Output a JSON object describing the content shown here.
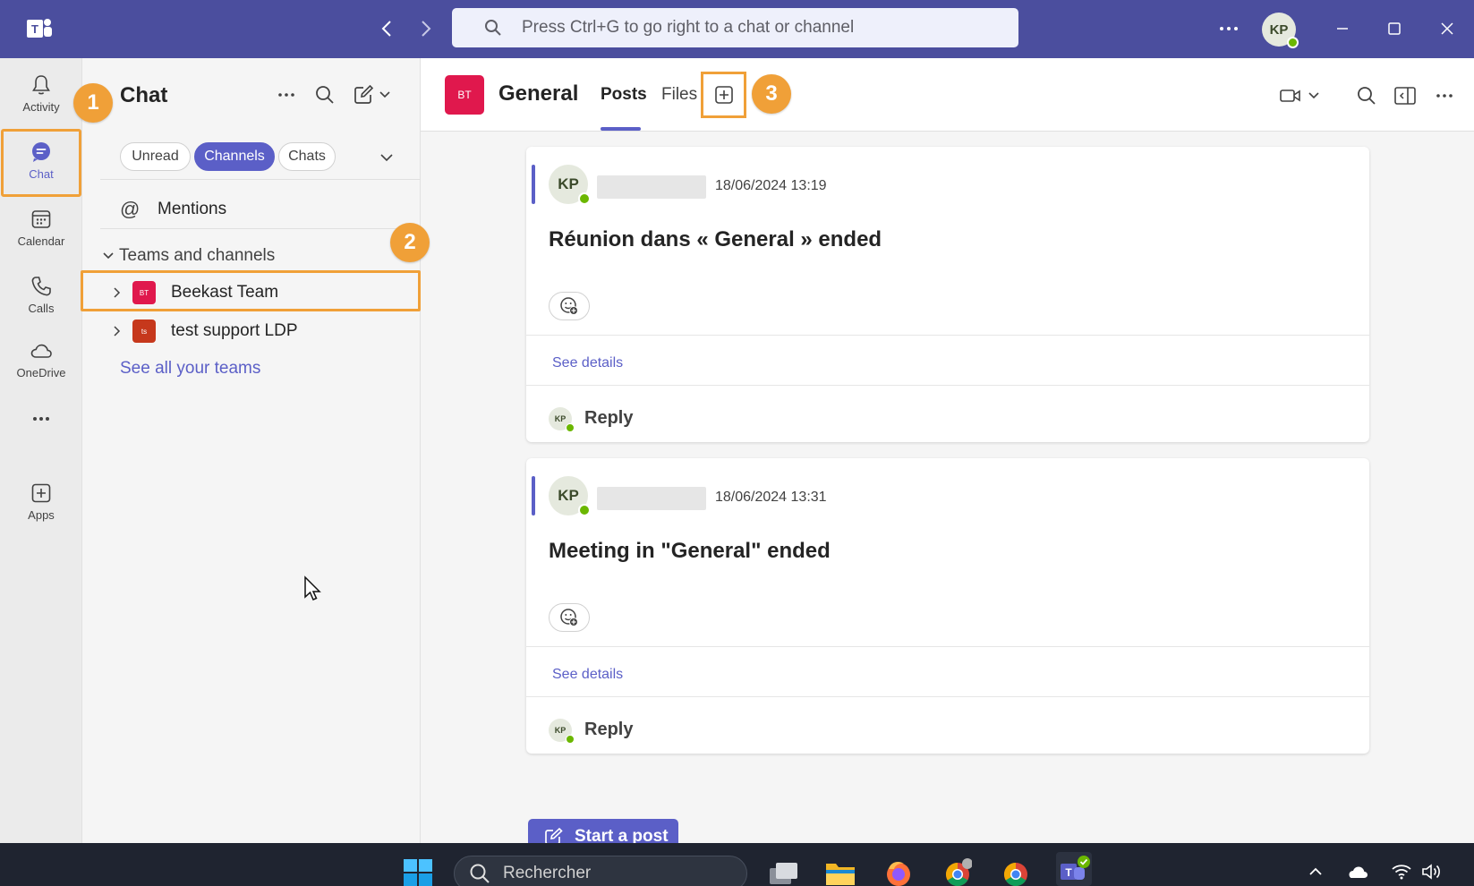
{
  "titlebar": {
    "search_placeholder": "Press Ctrl+G to go right to a chat or channel",
    "user_initials": "KP"
  },
  "rail": {
    "items": [
      {
        "label": "Activity",
        "icon": "bell-icon"
      },
      {
        "label": "Chat",
        "icon": "chat-icon",
        "active": true
      },
      {
        "label": "Calendar",
        "icon": "calendar-icon"
      },
      {
        "label": "Calls",
        "icon": "phone-icon"
      },
      {
        "label": "OneDrive",
        "icon": "cloud-icon"
      },
      {
        "label": "",
        "icon": "more-icon"
      },
      {
        "label": "Apps",
        "icon": "apps-icon"
      }
    ]
  },
  "chat_pane": {
    "title": "Chat",
    "filters": [
      {
        "label": "Unread",
        "active": false
      },
      {
        "label": "Channels",
        "active": true
      },
      {
        "label": "Chats",
        "active": false
      }
    ],
    "mentions_label": "Mentions",
    "section_title": "Teams and channels",
    "teams": [
      {
        "name": "Beekast Team",
        "initials": "BT",
        "color": "#e0184d"
      },
      {
        "name": "test support LDP",
        "initials": "ts",
        "color": "#c6381c"
      }
    ],
    "see_all_label": "See all your teams"
  },
  "channel": {
    "initials": "BT",
    "title": "General",
    "tabs": [
      {
        "label": "Posts",
        "active": true
      },
      {
        "label": "Files",
        "active": false
      }
    ]
  },
  "posts": [
    {
      "author_initials": "KP",
      "timestamp": "18/06/2024 13:19",
      "text": "Réunion dans « General » ended",
      "see_details_label": "See details",
      "reply_initials": "KP",
      "reply_label": "Reply"
    },
    {
      "author_initials": "KP",
      "timestamp": "18/06/2024 13:31",
      "text": "Meeting in \"General\" ended",
      "see_details_label": "See details",
      "reply_initials": "KP",
      "reply_label": "Reply"
    }
  ],
  "start_post_label": "Start a post",
  "step_badges": [
    "1",
    "2",
    "3"
  ],
  "taskbar": {
    "search_placeholder": "Rechercher"
  },
  "colors": {
    "brand": "#4b4e9e",
    "accent": "#5b5fc7",
    "highlight": "#f0a038",
    "presence": "#6bb700"
  }
}
